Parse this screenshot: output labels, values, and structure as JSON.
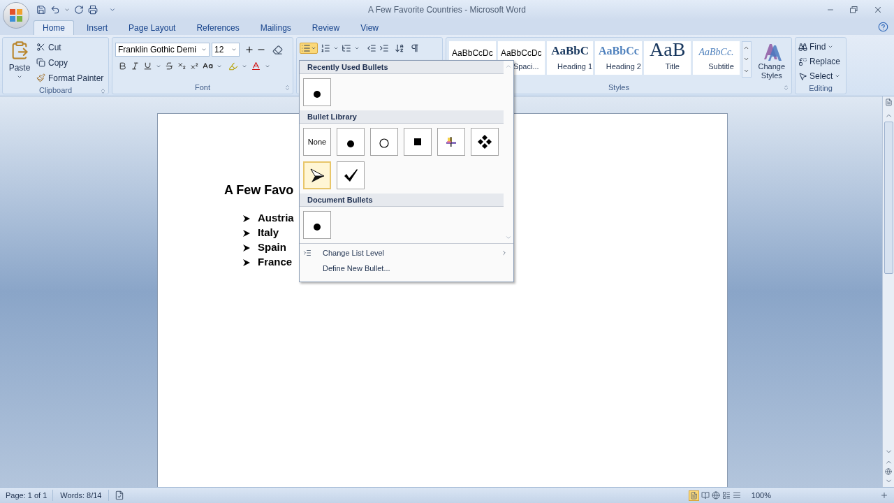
{
  "window": {
    "title": "A Few Favorite Countries - Microsoft Word"
  },
  "tabs": [
    {
      "label": "Home",
      "selected": true
    },
    {
      "label": "Insert",
      "selected": false
    },
    {
      "label": "Page Layout",
      "selected": false
    },
    {
      "label": "References",
      "selected": false
    },
    {
      "label": "Mailings",
      "selected": false
    },
    {
      "label": "Review",
      "selected": false
    },
    {
      "label": "View",
      "selected": false
    }
  ],
  "clipboard": {
    "paste": "Paste",
    "cut": "Cut",
    "copy": "Copy",
    "format_painter": "Format Painter",
    "group": "Clipboard"
  },
  "font": {
    "name": "Franklin Gothic Demi",
    "size": "12",
    "group": "Font"
  },
  "paragraph": {
    "bullets_active": true
  },
  "styles": {
    "items": [
      {
        "preview": "AaBbCcDc",
        "kind": "normal"
      },
      {
        "preview": "AaBbCcDc",
        "label": "Spaci...",
        "kind": "normal"
      },
      {
        "preview": "AaBbC",
        "label": "Heading 1",
        "kind": "heading1"
      },
      {
        "preview": "AaBbCc",
        "label": "Heading 2",
        "kind": "heading2"
      },
      {
        "preview": "AaB",
        "label": "Title",
        "kind": "title"
      },
      {
        "preview": "AaBbCc.",
        "label": "Subtitle",
        "kind": "subtitle"
      }
    ],
    "change": "Change Styles",
    "group": "Styles"
  },
  "editing": {
    "find": "Find",
    "replace": "Replace",
    "select": "Select",
    "group": "Editing"
  },
  "document": {
    "heading": "A Few Favo",
    "items": [
      "Austria",
      "Italy",
      "Spain",
      "France"
    ]
  },
  "bullet_menu": {
    "sections": [
      {
        "title": "Recently Used Bullets",
        "items": [
          {
            "kind": "dot",
            "highlighted": false
          }
        ]
      },
      {
        "title": "Bullet Library",
        "items": [
          {
            "kind": "none",
            "label": "None",
            "highlighted": false
          },
          {
            "kind": "dot",
            "highlighted": false
          },
          {
            "kind": "circle",
            "highlighted": false
          },
          {
            "kind": "square",
            "highlighted": false
          },
          {
            "kind": "star",
            "highlighted": false
          },
          {
            "kind": "diamonds",
            "highlighted": false
          },
          {
            "kind": "arrow",
            "highlighted": true
          },
          {
            "kind": "check",
            "highlighted": false
          }
        ]
      },
      {
        "title": "Document Bullets",
        "items": [
          {
            "kind": "dot",
            "highlighted": false
          }
        ]
      }
    ],
    "commands": [
      {
        "label": "Change List Level",
        "submenu": true
      },
      {
        "label": "Define New Bullet...",
        "submenu": false
      }
    ]
  },
  "status_bar": {
    "page": "Page: 1 of 1",
    "words": "Words: 8/14",
    "zoom": "100%"
  }
}
